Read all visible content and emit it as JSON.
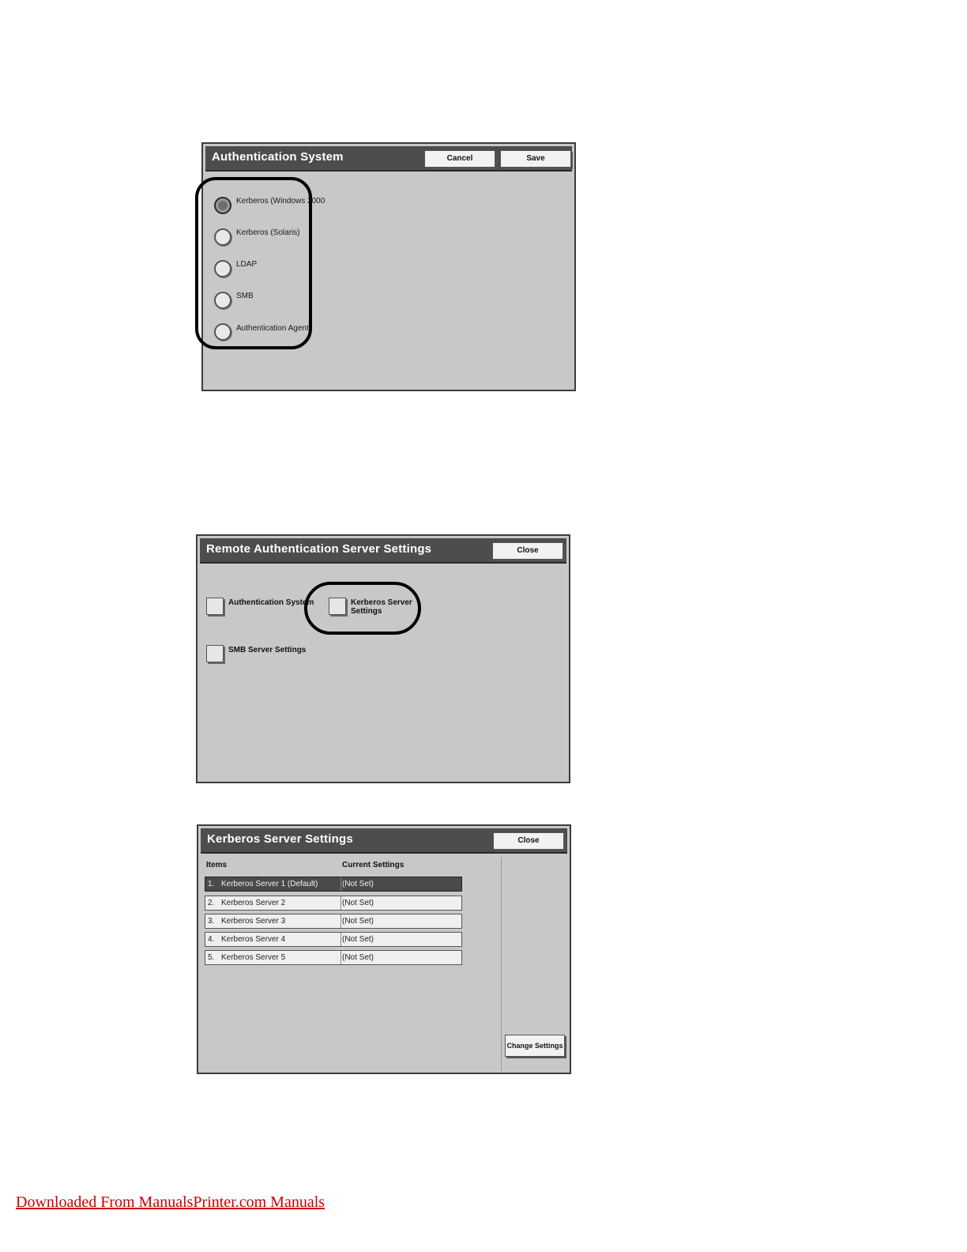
{
  "auth_system": {
    "title": "Authentication System",
    "cancel_label": "Cancel",
    "save_label": "Save",
    "options": [
      {
        "label": "Kerberos (Windows 2000",
        "selected": true
      },
      {
        "label": "Kerberos (Solaris)",
        "selected": false
      },
      {
        "label": "LDAP",
        "selected": false
      },
      {
        "label": "SMB",
        "selected": false
      },
      {
        "label": "Authentication Agent",
        "selected": false
      }
    ]
  },
  "remote_auth": {
    "title": "Remote Authentication Server Settings",
    "close_label": "Close",
    "buttons": [
      {
        "label": "Authentication System"
      },
      {
        "label_line1": "Kerberos Server",
        "label_line2": "Settings"
      },
      {
        "label": "SMB Server Settings"
      }
    ]
  },
  "kerberos_settings": {
    "title": "Kerberos Server Settings",
    "close_label": "Close",
    "col_items": "Items",
    "col_current": "Current Settings",
    "rows": [
      {
        "num": "1.",
        "item": "Kerberos Server 1 (Default)",
        "value": "(Not Set)",
        "selected": true
      },
      {
        "num": "2.",
        "item": "Kerberos Server 2",
        "value": "(Not Set)",
        "selected": false
      },
      {
        "num": "3.",
        "item": "Kerberos Server 3",
        "value": "(Not Set)",
        "selected": false
      },
      {
        "num": "4.",
        "item": "Kerberos Server 4",
        "value": "(Not Set)",
        "selected": false
      },
      {
        "num": "5.",
        "item": "Kerberos Server 5",
        "value": "(Not Set)",
        "selected": false
      }
    ],
    "change_label": "Change Settings"
  },
  "footer": {
    "link_text": "Downloaded From ManualsPrinter.com Manuals"
  }
}
